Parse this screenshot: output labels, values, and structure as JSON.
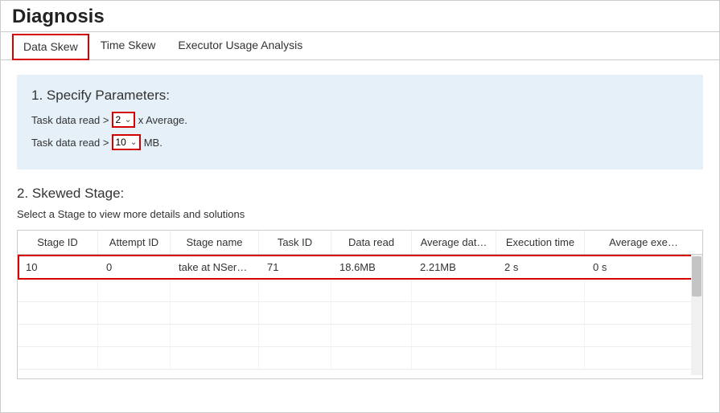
{
  "page_title": "Diagnosis",
  "tabs": [
    {
      "label": "Data Skew",
      "active": true
    },
    {
      "label": "Time Skew",
      "active": false
    },
    {
      "label": "Executor Usage Analysis",
      "active": false
    }
  ],
  "params": {
    "heading": "1. Specify Parameters:",
    "line1_prefix": "Task data read >",
    "line1_value": "2",
    "line1_suffix": "x Average.",
    "line2_prefix": "Task data read >",
    "line2_value": "10",
    "line2_suffix": "MB."
  },
  "stage": {
    "heading": "2. Skewed Stage:",
    "sub": "Select a Stage to view more details and solutions",
    "columns": [
      "Stage ID",
      "Attempt ID",
      "Stage name",
      "Task ID",
      "Data read",
      "Average dat…",
      "Execution time",
      "Average exe…"
    ],
    "rows": [
      {
        "stage_id": "10",
        "attempt_id": "0",
        "stage_name": "take at NSer…",
        "task_id": "71",
        "data_read": "18.6MB",
        "avg_data": "2.21MB",
        "exec_time": "2 s",
        "avg_exec": "0 s"
      }
    ]
  }
}
